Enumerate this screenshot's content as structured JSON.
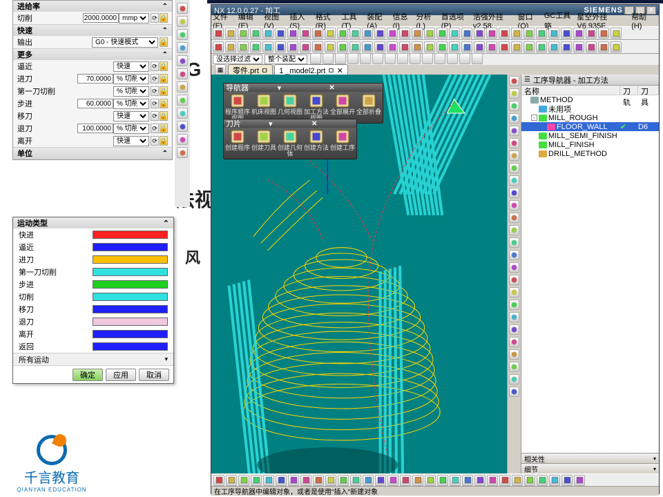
{
  "app": {
    "title": "NX 12.0.0.27 - 加工",
    "brand": "SIEMENS"
  },
  "menu": [
    "文件(F)",
    "编辑(E)",
    "视图(V)",
    "插入(S)",
    "格式(R)",
    "工具(T)",
    "装配(A)",
    "信息(I)",
    "分析(L)",
    "首选项(P)",
    "浩强外挂v2.58",
    "窗口(O)",
    "GC工具箱",
    "星空外挂 V6.935F",
    "帮助(H)"
  ],
  "filter": {
    "sel": "没选择过滤器",
    "scope": "整个装配"
  },
  "tabs": [
    "零件.prt  ㅁ",
    "1 _model2.prt  ㅁ ✕"
  ],
  "nav": {
    "title": "工序导航器 - 加工方法",
    "cols": [
      "名称",
      "刀轨",
      "刀具"
    ],
    "rows": [
      {
        "ind": 0,
        "exp": "",
        "ic": "#8aa",
        "t": "METHOD"
      },
      {
        "ind": 1,
        "exp": "",
        "ic": "#4ad",
        "t": "未用项"
      },
      {
        "ind": 1,
        "exp": "-",
        "ic": "#4d4",
        "t": "MILL_ROUGH"
      },
      {
        "ind": 2,
        "exp": "",
        "ic": "#f4a",
        "t": "FLOOR_WALL",
        "sel": true,
        "rc": "✔",
        "tool": "D6"
      },
      {
        "ind": 1,
        "exp": "",
        "ic": "#4d4",
        "t": "MILL_SEMI_FINISH"
      },
      {
        "ind": 1,
        "exp": "",
        "ic": "#4d4",
        "t": "MILL_FINISH"
      },
      {
        "ind": 1,
        "exp": "",
        "ic": "#da4",
        "t": "DRILL_METHOD"
      }
    ],
    "acc1": "相关性",
    "acc2": "细节"
  },
  "float1": {
    "title": "导航器",
    "closeIcon": "✕",
    "items": [
      "程序顺序视图",
      "机床视图",
      "几何视图",
      "加工方法视图",
      "全部展开",
      "全部折叠"
    ]
  },
  "float2": {
    "title": "刀片",
    "closeIcon": "✕",
    "items": [
      "创建程序",
      "创建刀具",
      "创建几何体",
      "创建方法",
      "创建工序"
    ]
  },
  "status": "在工序导航器中编辑对象，或者是使用\"插入\"新建对象",
  "feed": {
    "head": "进给率",
    "cut_l": "切削",
    "cut_v": "2000.0000",
    "cut_u": "mmpm",
    "rapid": "快速",
    "out_l": "输出",
    "out_v": "G0 - 快速模式",
    "more": "更多",
    "rows": [
      {
        "l": "逼近",
        "sel": "快速"
      },
      {
        "l": "进刀",
        "v": "70.0000",
        "sel": "% 切削"
      },
      {
        "l": "第一刀切削",
        "sel": "% 切削"
      },
      {
        "l": "步进",
        "v": "60.0000",
        "sel": "% 切削"
      },
      {
        "l": "移刀",
        "sel": "快速"
      },
      {
        "l": "退刀",
        "v": "100.0000",
        "sel": "% 切削"
      },
      {
        "l": "离开",
        "sel": "快速"
      }
    ],
    "unit": "单位"
  },
  "motion": {
    "title": "运动类型",
    "rows": [
      {
        "l": "快进",
        "c": "#ff2020"
      },
      {
        "l": "逼近",
        "c": "#2020ff"
      },
      {
        "l": "进刀",
        "c": "#ffc000"
      },
      {
        "l": "第一刀切削",
        "c": "#30e0e0"
      },
      {
        "l": "步进",
        "c": "#20d020"
      },
      {
        "l": "切削",
        "c": "#30e0e0"
      },
      {
        "l": "移刀",
        "c": "#2020ff"
      },
      {
        "l": "退刀",
        "c": "#f0c8e0"
      },
      {
        "l": "离开",
        "c": "#2020ff"
      },
      {
        "l": "返回",
        "c": "#2020ff"
      }
    ],
    "all": "所有运动",
    "ok": "确定",
    "apply": "应用",
    "cancel": "取消"
  },
  "bgtext": {
    "a": "法视",
    "b": "JG",
    "c": "风"
  },
  "logo": {
    "t1": "千言教育",
    "t2": "QIANYAN EDUCATION"
  }
}
